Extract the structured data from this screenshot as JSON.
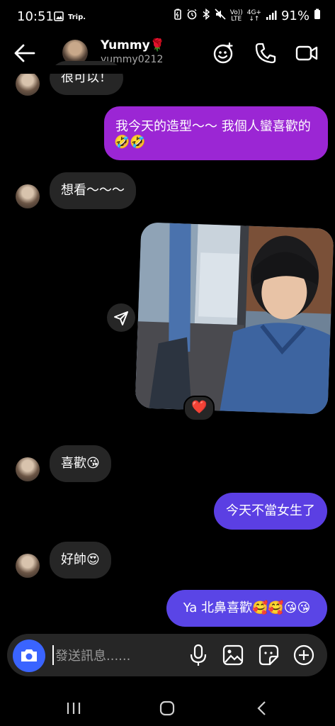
{
  "status_bar": {
    "time": "10:51",
    "app_badge": "Trip.",
    "network_top": "Vo))",
    "network_bottom": "LTE",
    "data_type": "4G+",
    "battery": "91%"
  },
  "header": {
    "name": "Yummy🌹",
    "username": "yummy0212",
    "icons": [
      "back-arrow-icon",
      "effects-icon",
      "phone-icon",
      "video-icon"
    ]
  },
  "messages": [
    {
      "side": "in",
      "text": "很可以！"
    },
    {
      "side": "out",
      "line1": "我今天的造型～～ 我個人蠻喜歡的",
      "line2": "🤣🤣",
      "color": "#9B26D4"
    },
    {
      "side": "in",
      "text": "想看～～～"
    },
    {
      "side": "out",
      "type": "photo",
      "reaction": "❤️"
    },
    {
      "side": "in",
      "text": "喜歡😘"
    },
    {
      "side": "out",
      "text": "今天不當女生了",
      "color": "#5B3FE3"
    },
    {
      "side": "in",
      "text": "好帥😍"
    },
    {
      "side": "out",
      "text": "Ya  北鼻喜歡🥰🥰😘😘",
      "color": "#5A45E6"
    }
  ],
  "composer": {
    "placeholder": "發送訊息......",
    "icons": [
      "camera-icon",
      "microphone-icon",
      "gallery-icon",
      "sticker-icon",
      "plus-icon"
    ]
  },
  "colors": {
    "background": "#000000",
    "incoming_bubble": "#262626",
    "camera_button": "#3A64FF"
  }
}
